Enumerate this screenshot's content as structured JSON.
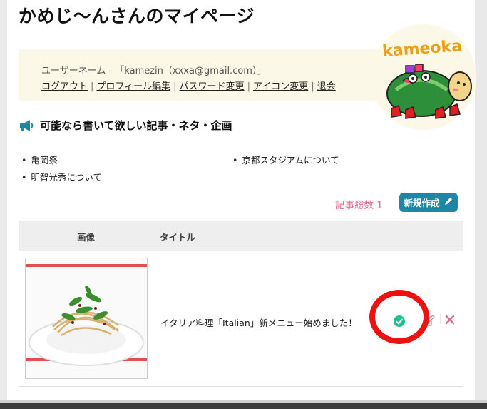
{
  "page": {
    "title": "かめじ〜んさんのマイページ"
  },
  "user": {
    "info": "ユーザーネーム - 「kamezin（xxxa@gmail.com）」",
    "links": [
      "ログアウト",
      "プロフィール編集",
      "パスワード変更",
      "アイコン変更",
      "退会"
    ]
  },
  "logo": {
    "text": "kameoka"
  },
  "requests": {
    "heading": "可能なら書いて欲しい記事・ネタ・企画",
    "left": [
      "亀岡祭",
      "明智光秀について"
    ],
    "right": [
      "京都スタジアムについて"
    ]
  },
  "articles": {
    "count_label": "記事総数 1",
    "new_button": "新規作成",
    "headers": {
      "image": "画像",
      "title": "タイトル"
    },
    "rows": [
      {
        "title": "イタリア料理「Italian」新メニュー始めました！"
      }
    ]
  },
  "colors": {
    "accent": "#1e87a6",
    "count": "#e06a8a",
    "status_check": "#1fbf8f",
    "highlight_ring": "#ee1111",
    "user_box": "#fbf8e8"
  }
}
